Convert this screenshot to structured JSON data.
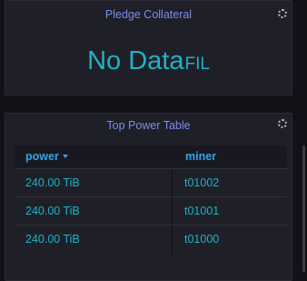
{
  "pledge": {
    "title": "Pledge Collateral",
    "value": "No Data",
    "unit": "FIL"
  },
  "power_table": {
    "title": "Top Power Table",
    "columns": {
      "power": "power",
      "miner": "miner"
    },
    "rows": [
      {
        "power": "240.00 TiB",
        "miner": "t01002"
      },
      {
        "power": "240.00 TiB",
        "miner": "t01001"
      },
      {
        "power": "240.00 TiB",
        "miner": "t01000"
      }
    ]
  },
  "colors": {
    "title": "#7b8ee8",
    "value": "#1fb2c6",
    "header": "#33a2e5",
    "panel": "#1f1f28",
    "background": "#111217"
  },
  "icons": {
    "panel_loading": "loading-spinner-icon",
    "sort": "caret-down-icon"
  }
}
